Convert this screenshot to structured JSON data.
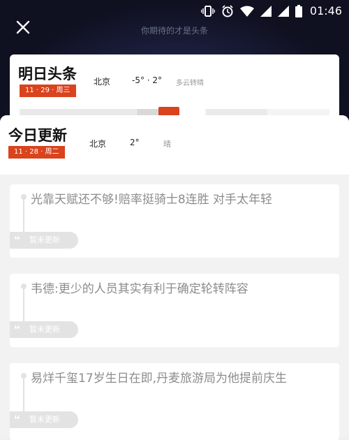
{
  "status_bar": {
    "time": "01:46"
  },
  "slogan": "你期待的才是头条",
  "back_card": {
    "title": "明日头条",
    "date": "11 · 29 · 周三",
    "city": "北京",
    "temp": "-5°  ·  2°",
    "weather": "多云转晴"
  },
  "today": {
    "title": "今日更新",
    "date": "11 · 28 · 周二",
    "city": "北京",
    "temp": "2°",
    "weather": "晴"
  },
  "news": [
    {
      "title": "光靠天赋还不够!赔率挺骑士8连胜 对手太年轻",
      "status": "暂未更新"
    },
    {
      "title": "韦德:更少的人员其实有利于确定轮转阵容",
      "status": "暂未更新"
    },
    {
      "title": "易烊千玺17岁生日在即,丹麦旅游局为他提前庆生",
      "status": "暂未更新"
    }
  ]
}
